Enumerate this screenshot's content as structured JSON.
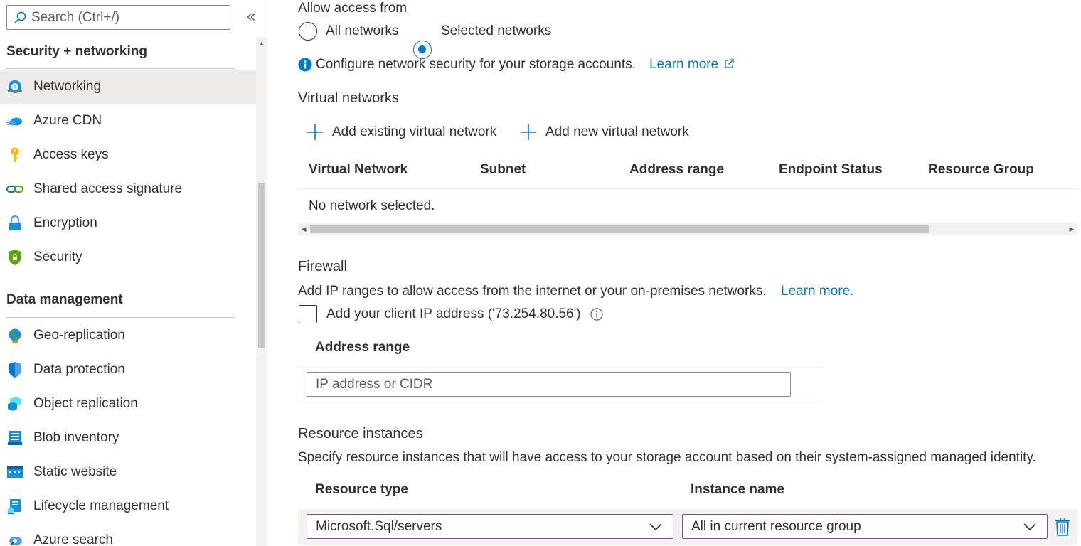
{
  "sidebar": {
    "search_placeholder": "Search (Ctrl+/)",
    "collapse_glyph": "«",
    "groups": [
      {
        "header": "Security + networking",
        "items": [
          {
            "label": "Networking",
            "icon": "networking-icon",
            "selected": true
          },
          {
            "label": "Azure CDN",
            "icon": "cloud-icon"
          },
          {
            "label": "Access keys",
            "icon": "key-icon"
          },
          {
            "label": "Shared access signature",
            "icon": "link-icon"
          },
          {
            "label": "Encryption",
            "icon": "lock-icon"
          },
          {
            "label": "Security",
            "icon": "shield-icon"
          }
        ]
      },
      {
        "header": "Data management",
        "items": [
          {
            "label": "Geo-replication",
            "icon": "globe-icon"
          },
          {
            "label": "Data protection",
            "icon": "shield-check-icon"
          },
          {
            "label": "Object replication",
            "icon": "cubes-icon"
          },
          {
            "label": "Blob inventory",
            "icon": "inventory-icon"
          },
          {
            "label": "Static website",
            "icon": "website-icon"
          },
          {
            "label": "Lifecycle management",
            "icon": "lifecycle-icon"
          },
          {
            "label": "Azure search",
            "icon": "azure-search-icon"
          }
        ]
      }
    ]
  },
  "access": {
    "label": "Allow access from",
    "options": [
      {
        "label": "All networks",
        "checked": false
      },
      {
        "label": "Selected networks",
        "checked": true
      }
    ]
  },
  "info": {
    "text": "Configure network security for your storage accounts.",
    "link": "Learn more"
  },
  "vnet": {
    "title": "Virtual networks",
    "add_existing": "Add existing virtual network",
    "add_new": "Add new virtual network",
    "columns": [
      "Virtual Network",
      "Subnet",
      "Address range",
      "Endpoint Status",
      "Resource Group"
    ],
    "empty": "No network selected."
  },
  "firewall": {
    "title": "Firewall",
    "description": "Add IP ranges to allow access from the internet or your on-premises networks.",
    "link": "Learn more.",
    "client_ip_label": "Add your client IP address ('73.254.80.56')",
    "client_ip_checked": false,
    "address_header": "Address range",
    "address_placeholder": "IP address or CIDR"
  },
  "resources": {
    "title": "Resource instances",
    "description": "Specify resource instances that will have access to your storage account based on their system-assigned managed identity.",
    "col_type": "Resource type",
    "col_instance": "Instance name",
    "row": {
      "type": "Microsoft.Sql/servers",
      "instance": "All in current resource group"
    }
  },
  "colors": {
    "accent": "#0078d4",
    "dropdown_border": "#8a3ec2",
    "selected_bg": "#edebe9"
  }
}
